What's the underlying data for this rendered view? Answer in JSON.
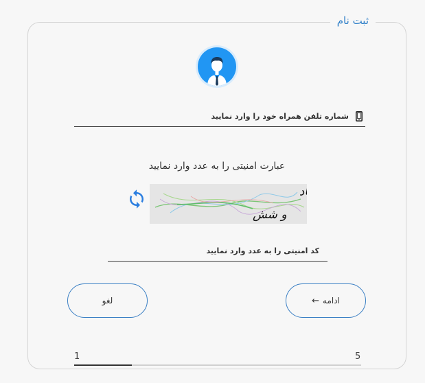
{
  "form": {
    "title": "ثبت نام",
    "phone_placeholder": "شماره تلفن همراه خود را وارد نمایید",
    "captcha_label": "عبارت امنیتی را به عدد وارد نمایید",
    "captcha_text_line1": "یک هزار و یکصد و هفتاد",
    "captcha_text_line2": "و شش",
    "code_placeholder": "کد امنیتی را به عدد وارد نمایید",
    "continue_label": "ادامه",
    "cancel_label": "لغو"
  },
  "progress": {
    "current_step": "1",
    "total_steps": "5",
    "fraction": 0.2
  },
  "icons": {
    "avatar": "user-avatar-icon",
    "phone": "mobile-phone-icon",
    "refresh": "refresh-icon",
    "arrow": "arrow-left-icon"
  },
  "colors": {
    "accent": "#2196f3",
    "border": "#3a7fc4",
    "title": "#2f7fc8"
  }
}
